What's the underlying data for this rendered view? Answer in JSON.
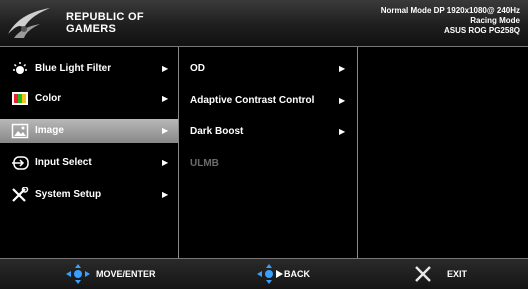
{
  "brand": {
    "line1": "REPUBLIC OF",
    "line2": "GAMERS"
  },
  "status": {
    "line1": "Normal Mode DP 1920x1080@ 240Hz",
    "line2": "Racing Mode",
    "line3": "ASUS ROG PG258Q"
  },
  "main_menu": [
    {
      "label": "Blue Light Filter",
      "icon": "blue-light-icon",
      "selected": false
    },
    {
      "label": "Color",
      "icon": "color-icon",
      "selected": false
    },
    {
      "label": "Image",
      "icon": "image-icon",
      "selected": true
    },
    {
      "label": "Input Select",
      "icon": "input-select-icon",
      "selected": false
    },
    {
      "label": "System Setup",
      "icon": "system-setup-icon",
      "selected": false
    }
  ],
  "sub_menu": [
    {
      "label": "OD",
      "has_arrow": true,
      "enabled": true
    },
    {
      "label": "Adaptive Contrast Control",
      "has_arrow": true,
      "enabled": true
    },
    {
      "label": "Dark Boost",
      "has_arrow": true,
      "enabled": true
    },
    {
      "label": "ULMB",
      "has_arrow": false,
      "enabled": false
    }
  ],
  "footer": {
    "move_enter": "MOVE/ENTER",
    "back": "BACK",
    "exit": "EXIT"
  },
  "colors": {
    "accent_blue": "#3aa0ff",
    "exit_x": "#e8e8e8",
    "selected_bg": "#a0a0a0",
    "disabled_text": "#6b6b6b"
  }
}
